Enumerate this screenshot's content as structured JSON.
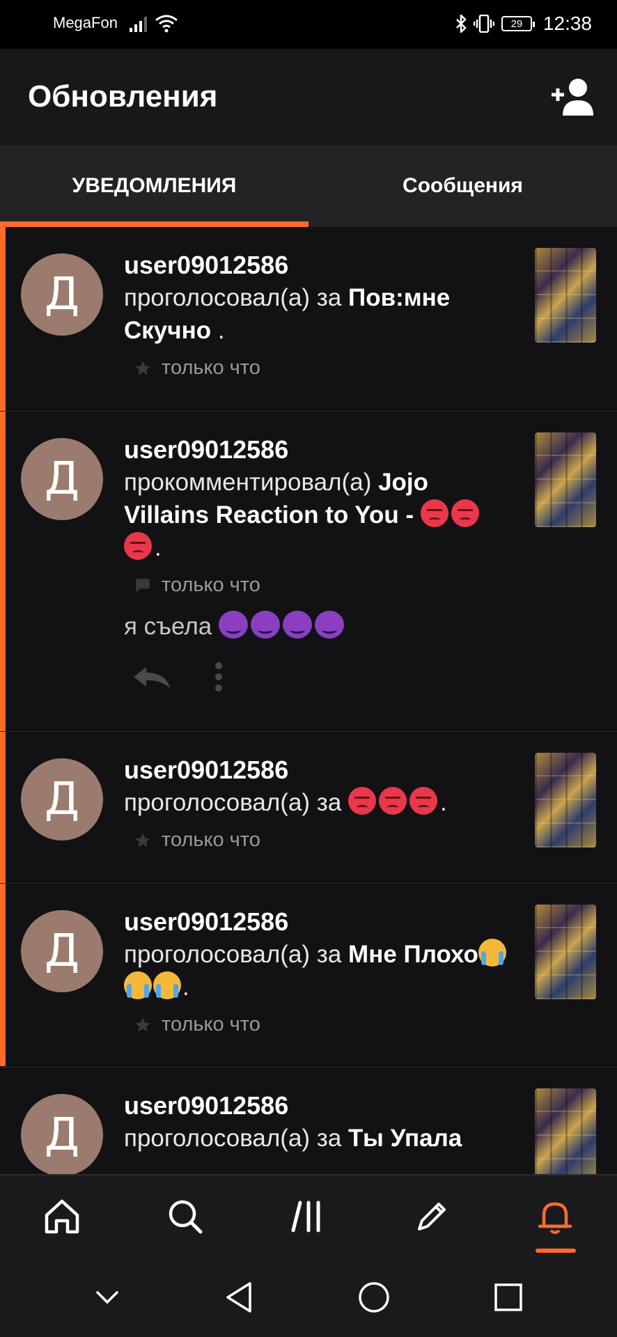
{
  "status_bar": {
    "carrier": "MegaFon",
    "battery": "29",
    "time": "12:38"
  },
  "header": {
    "title": "Обновления",
    "add_user_icon": "add-person-icon"
  },
  "tabs": [
    {
      "label": "УВЕДОМЛЕНИЯ",
      "active": true
    },
    {
      "label": "Сообщения",
      "active": false
    }
  ],
  "notifications": [
    {
      "avatar_letter": "Д",
      "username": "user09012586",
      "action": "проголосовал(а) за ",
      "story": "Пов:мне Скучно",
      "suffix": " .",
      "meta_icon": "star-icon",
      "time": "только что"
    },
    {
      "avatar_letter": "Д",
      "username": "user09012586",
      "action": "прокомментировал(а) ",
      "story": "Jojo Villains Reaction to You - ",
      "suffix": ".",
      "meta_icon": "comment-icon",
      "time": "только что",
      "comment": "я съела "
    },
    {
      "avatar_letter": "Д",
      "username": "user09012586",
      "action": "проголосовал(а) за ",
      "suffix": ".",
      "meta_icon": "star-icon",
      "time": "только что"
    },
    {
      "avatar_letter": "Д",
      "username": "user09012586",
      "action": "проголосовал(а) за ",
      "story": "Мне Плохо",
      "suffix": ".",
      "meta_icon": "star-icon",
      "time": "только что"
    },
    {
      "avatar_letter": "Д",
      "username": "user09012586",
      "action": "проголосовал(а) за ",
      "story": "Ты Упала"
    }
  ],
  "bottom_nav": [
    "home-icon",
    "search-icon",
    "library-icon",
    "write-icon",
    "notifications-bell-icon"
  ],
  "accent_color": "#ff6b2b"
}
